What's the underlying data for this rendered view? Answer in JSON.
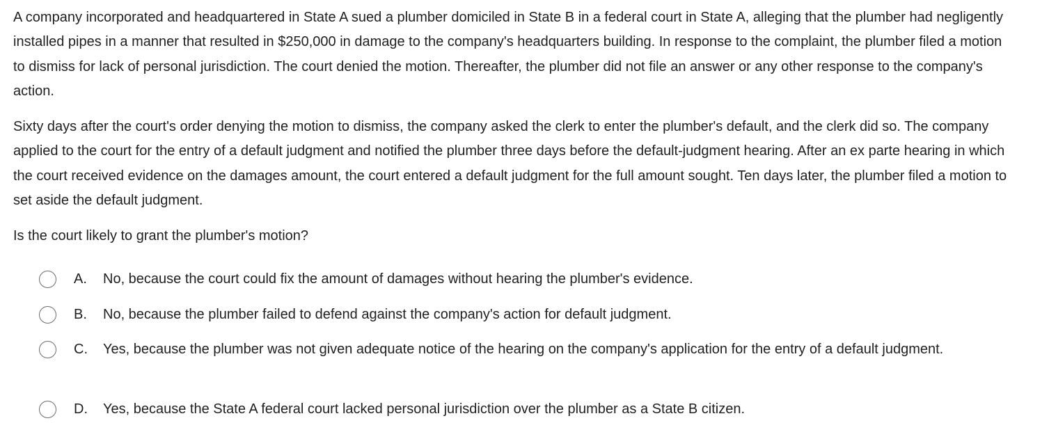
{
  "question": {
    "paragraphs": [
      "A company incorporated and headquartered in State A sued a plumber domiciled in State B in a federal court in State A, alleging that the plumber had negligently installed pipes in a manner that resulted in $250,000 in damage to the company's headquarters building.  In response to the complaint, the plumber filed a motion to dismiss for lack of personal jurisdiction.  The court denied the motion.  Thereafter, the plumber did not file an answer or any other response to the company's action.",
      "Sixty days after the court's order denying the motion to dismiss, the company asked the clerk to enter the plumber's default, and the clerk did so.  The company applied to the court for the entry of a default judgment and notified the plumber three days before the default-judgment hearing.  After an ex parte hearing in which the court received evidence on the damages amount, the court entered a default judgment for the full amount sought.  Ten days later, the plumber filed a motion to set aside the default judgment."
    ],
    "stem": "Is the court likely to grant the plumber's motion?"
  },
  "options": [
    {
      "letter": "A.",
      "text": "No, because the court could fix the amount of damages without hearing the plumber's evidence."
    },
    {
      "letter": "B.",
      "text": "No, because the plumber failed to defend against the company's action for default judgment."
    },
    {
      "letter": "C.",
      "text": "Yes, because the plumber was not given adequate notice of the hearing on the company's application for the entry of a default judgment."
    },
    {
      "letter": "D.",
      "text": "Yes, because the State A federal court lacked personal jurisdiction over the plumber as a State B citizen."
    }
  ]
}
